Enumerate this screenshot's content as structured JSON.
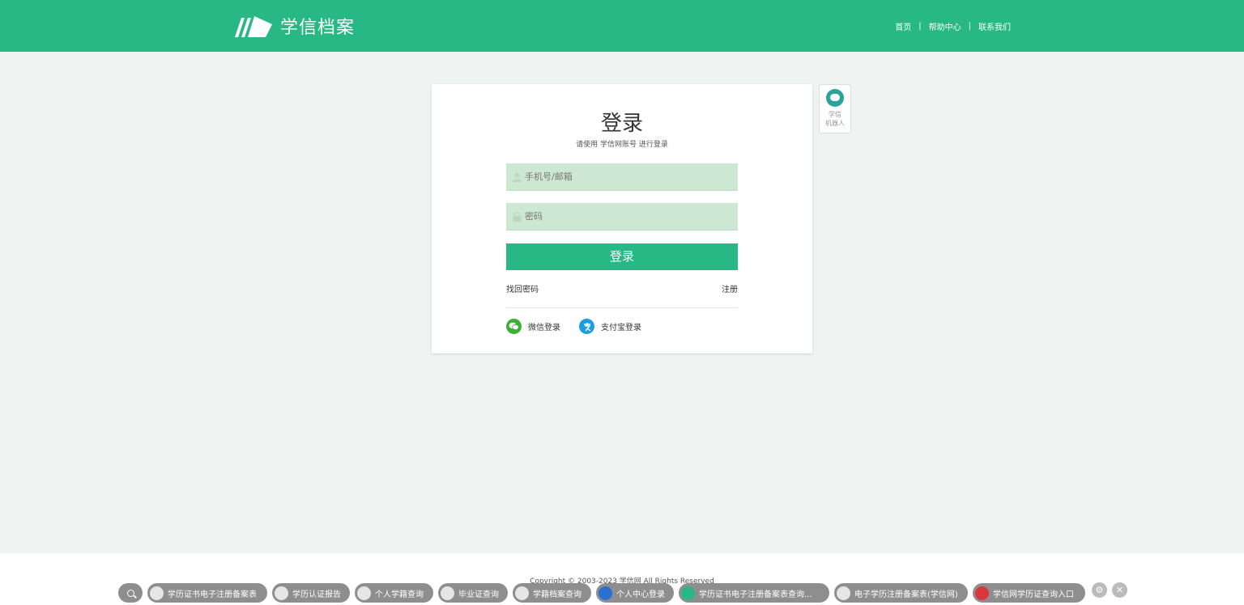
{
  "header": {
    "logo_text": "学信档案",
    "nav": [
      {
        "label": "首页"
      },
      {
        "label": "帮助中心"
      },
      {
        "label": "联系我们"
      }
    ],
    "separator": "|",
    "bg_color": "#27b886"
  },
  "login": {
    "title": "登录",
    "subtitle": "请使用 学信网账号 进行登录",
    "username_placeholder": "手机号/邮箱",
    "password_placeholder": "密码",
    "submit_label": "登录",
    "forgot_label": "找回密码",
    "register_label": "注册",
    "wechat_label": "微信登录",
    "alipay_label": "支付宝登录"
  },
  "robot": {
    "line1": "学信",
    "line2": "机器人"
  },
  "footer": {
    "copyright": "Copyright © 2003-2023 学信网 All Rights Reserved"
  },
  "toolbar": {
    "items": [
      "学历证书电子注册备案表",
      "学历认证报告",
      "个人学籍查询",
      "毕业证查询",
      "学籍档案查询",
      "个人中心登录",
      "学历证书电子注册备案表查询...",
      "电子学历注册备案表(学信网)",
      "学信网学历证查询入口"
    ],
    "settings_icon": "gear-icon",
    "close_icon": "close-icon"
  }
}
